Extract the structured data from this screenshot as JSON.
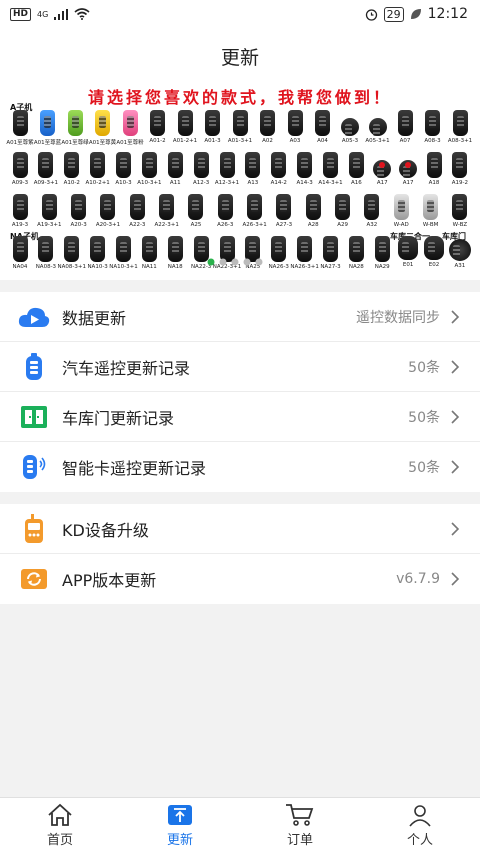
{
  "status_bar": {
    "hd": "HD",
    "network": "4G",
    "battery": "29",
    "time": "12:12"
  },
  "header": {
    "title": "更新"
  },
  "banner": {
    "slogan": "请选择您喜欢的款式，我帮您做到！",
    "groups": {
      "a": "A子机",
      "na": "NA子机",
      "garage_combo": "车库二合一",
      "garage": "车库门"
    },
    "rows": [
      [
        "A01至尊紫",
        "A01至尊蓝",
        "A01至尊绿",
        "A01至尊黄",
        "A01至尊粉",
        "A01-2",
        "A01-2+1",
        "A01-3",
        "A01-3+1",
        "A02",
        "A03",
        "A04",
        "A05-3",
        "A05-3+1",
        "A07",
        "A08-3",
        "A08-3+1"
      ],
      [
        "A09-3",
        "A09-3+1",
        "A10-2",
        "A10-2+1",
        "A10-3",
        "A10-3+1",
        "A11",
        "A12-3",
        "A12-3+1",
        "A13",
        "A14-2",
        "A14-3",
        "A14-3+1",
        "A16",
        "A17",
        "A17",
        "A18",
        "A19-2"
      ],
      [
        "A19-3",
        "A19-3+1",
        "A20-3",
        "A20-3+1",
        "A22-3",
        "A22-3+1",
        "A25",
        "A26-3",
        "A26-3+1",
        "A27-3",
        "A28",
        "A29",
        "A32",
        "W-AD",
        "W-BM",
        "W-BZ"
      ],
      [
        "NA04",
        "NA08-3",
        "NA08-3+1",
        "NA10-3",
        "NA10-3+1",
        "NA11",
        "NA18",
        "NA22-3",
        "NA22-3+1",
        "NA25",
        "NA26-3",
        "NA26-3+1",
        "NA27-3",
        "NA28",
        "NA29",
        "E01",
        "E02",
        "A31"
      ]
    ]
  },
  "section1": [
    {
      "icon": "cloud-play-icon",
      "label": "数据更新",
      "value": "遥控数据同步"
    },
    {
      "icon": "car-remote-icon",
      "label": "汽车遥控更新记录",
      "value": "50条"
    },
    {
      "icon": "garage-door-icon",
      "label": "车库门更新记录",
      "value": "50条"
    },
    {
      "icon": "smart-key-icon",
      "label": "智能卡遥控更新记录",
      "value": "50条"
    }
  ],
  "section2": [
    {
      "icon": "kd-device-icon",
      "label": "KD设备升级",
      "value": ""
    },
    {
      "icon": "app-refresh-icon",
      "label": "APP版本更新",
      "value": "v6.7.9"
    }
  ],
  "bottom_nav": [
    {
      "icon": "home-icon",
      "label": "首页"
    },
    {
      "icon": "upload-icon",
      "label": "更新",
      "active": true
    },
    {
      "icon": "cart-icon",
      "label": "订单"
    },
    {
      "icon": "person-icon",
      "label": "个人"
    }
  ],
  "colors": {
    "accent": "#1a74e8",
    "orange": "#f39a2c",
    "green": "#1bb05a"
  }
}
